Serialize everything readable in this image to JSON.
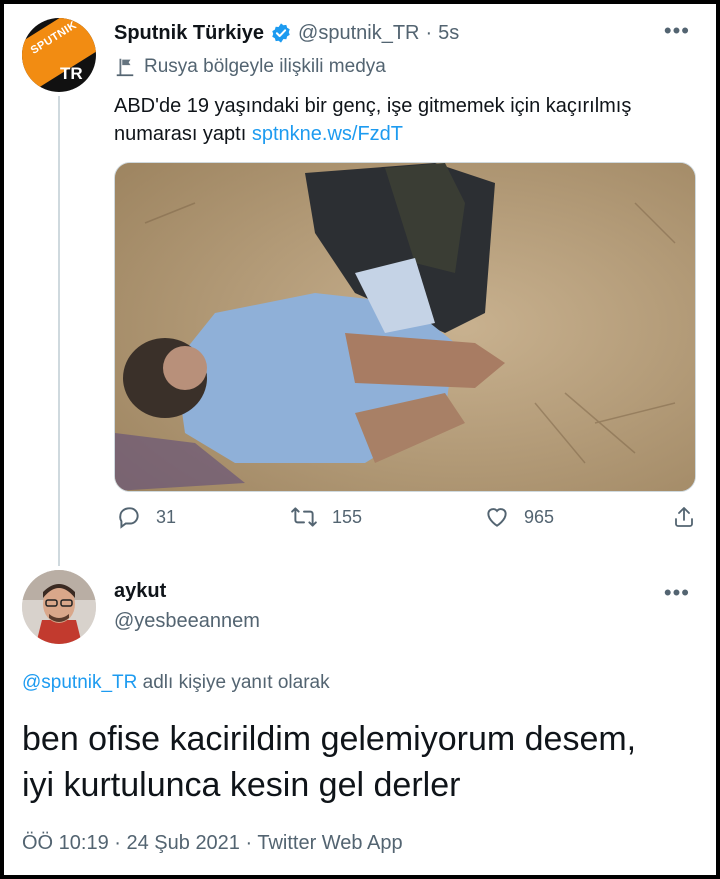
{
  "tweet": {
    "author_name": "Sputnik Türkiye",
    "handle": "@sputnik_TR",
    "separator": "·",
    "time": "5s",
    "more": "•••",
    "avatar_brand": "SPUTNIK",
    "avatar_badge": "TR",
    "label": "Rusya bölgeyle ilişkili medya",
    "text": "ABD'de 19 yaşındaki bir genç, işe gitmemek için kaçırılmış numarası yaptı",
    "link": "sptnkne.ws/FzdT",
    "replies": "31",
    "retweets": "155",
    "likes": "965",
    "icons": {
      "verified": "verified-badge-icon",
      "label": "state-media-flag-icon",
      "reply": "reply-icon",
      "retweet": "retweet-icon",
      "like": "heart-icon",
      "share": "share-icon"
    }
  },
  "reply": {
    "author_name": "aykut",
    "handle": "@yesbeeannem",
    "more": "•••",
    "reply_to_handle": "@sputnik_TR",
    "reply_to_suffix": " adlı kişiye yanıt olarak",
    "text_line1": "ben ofise kacirildim gelemiyorum desem,",
    "text_line2": "iyi kurtulunca kesin gel derler",
    "meta": "ÖÖ 10:19 · 24 Şub 2021 · Twitter Web App"
  },
  "colors": {
    "accent": "#1d9bf0",
    "muted": "#536471",
    "text": "#0f1419",
    "brand_orange": "#f28c12"
  }
}
